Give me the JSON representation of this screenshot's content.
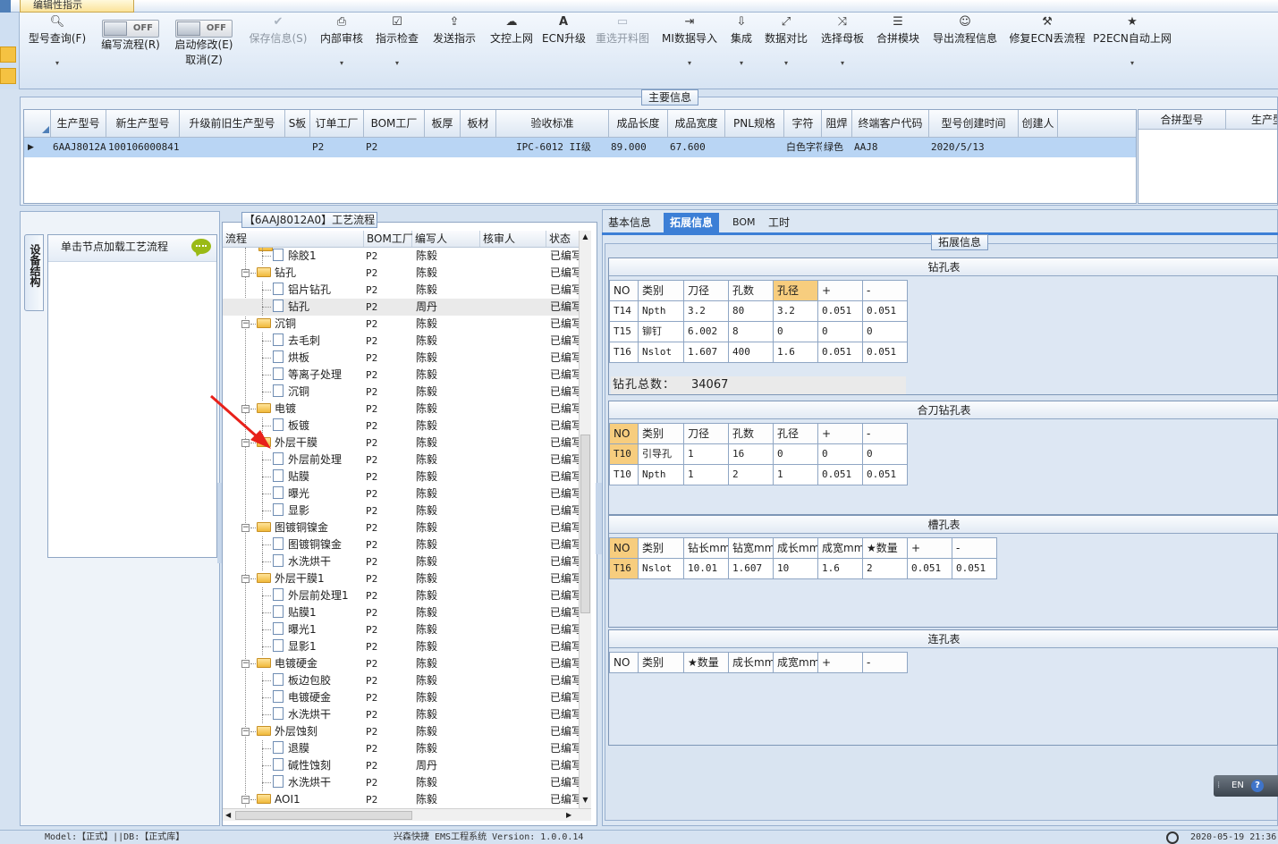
{
  "window": {
    "doc_tab": "编辑性指示"
  },
  "ribbon": {
    "buttons": [
      {
        "label": "型号查询(F)",
        "icon": "search-icon",
        "enabled": true,
        "dropdown": true
      },
      {
        "label": "保存信息(S)",
        "icon": "check-icon",
        "enabled": false
      },
      {
        "label": "内部审核",
        "icon": "print-icon",
        "enabled": true,
        "dropdown": true
      },
      {
        "label": "指示检查",
        "icon": "checkbox-icon",
        "enabled": true,
        "dropdown": true
      },
      {
        "label": "发送指示",
        "icon": "upload-icon",
        "enabled": true
      },
      {
        "label": "文控上网",
        "icon": "cloud-upload-icon",
        "enabled": true
      },
      {
        "label": "ECN升级",
        "icon": "ecn-icon",
        "enabled": true
      },
      {
        "label": "重选开料图",
        "icon": "image-icon",
        "enabled": false
      },
      {
        "label": "MI数据导入",
        "icon": "import-icon",
        "enabled": true,
        "dropdown": true
      },
      {
        "label": "集成",
        "icon": "download-icon",
        "enabled": true,
        "dropdown": true
      },
      {
        "label": "数据对比",
        "icon": "compare-icon",
        "enabled": true,
        "dropdown": true
      },
      {
        "label": "选择母板",
        "icon": "shuffle-icon",
        "enabled": true,
        "dropdown": true
      },
      {
        "label": "合拼模块",
        "icon": "list-icon",
        "enabled": true
      },
      {
        "label": "导出流程信息",
        "icon": "smiley-icon",
        "enabled": true
      },
      {
        "label": "修复ECN丢流程",
        "icon": "wrench-icon",
        "enabled": true
      },
      {
        "label": "P2ECN自动上网",
        "icon": "star-icon",
        "enabled": true,
        "dropdown": true
      }
    ],
    "toggles": [
      {
        "state": "OFF",
        "label1": "编写流程(R)",
        "label2": ""
      },
      {
        "state": "OFF",
        "label1": "启动修改(E)",
        "label2": "取消(Z)"
      }
    ]
  },
  "main_info": {
    "title": "主要信息",
    "columns": [
      "生产型号",
      "新生产型号",
      "升级前旧生产型号",
      "S板",
      "订单工厂",
      "BOM工厂",
      "板厚",
      "板材",
      "验收标准",
      "成品长度",
      "成品宽度",
      "PNL规格",
      "字符",
      "阻焊",
      "终端客户代码",
      "型号创建时间",
      "创建人"
    ],
    "row": [
      "6AAJ8012A0",
      "10010600084143",
      "",
      "",
      "P2",
      "P2",
      "",
      "",
      "IPC-6012 II级",
      "89.000",
      "67.600",
      "",
      "白色字符",
      "绿色",
      "AAJ8",
      "2020/5/13",
      ""
    ],
    "side_columns": [
      "合拼型号",
      "生产型"
    ]
  },
  "left_panel": {
    "vertical_tab": "设备结构",
    "hint": "单击节点加载工艺流程"
  },
  "flow": {
    "title": "【6AAJ8012A0】工艺流程",
    "columns": [
      "流程",
      "BOM工厂",
      "编写人",
      "核审人",
      "状态"
    ],
    "rows": [
      {
        "name": "除胶1",
        "level": 1,
        "type": "doc",
        "bom": "P2",
        "author": "陈毅",
        "reviewer": "",
        "status": "已编写"
      },
      {
        "name": "钻孔",
        "level": 0,
        "type": "folder",
        "bom": "P2",
        "author": "陈毅",
        "reviewer": "",
        "status": "已编写"
      },
      {
        "name": "铝片钻孔",
        "level": 1,
        "type": "doc",
        "bom": "P2",
        "author": "陈毅",
        "reviewer": "",
        "status": "已编写"
      },
      {
        "name": "钻孔",
        "level": 1,
        "type": "doc",
        "bom": "P2",
        "author": "周丹",
        "reviewer": "",
        "status": "已编写",
        "selected": true
      },
      {
        "name": "沉铜",
        "level": 0,
        "type": "folder",
        "bom": "P2",
        "author": "陈毅",
        "reviewer": "",
        "status": "已编写"
      },
      {
        "name": "去毛刺",
        "level": 1,
        "type": "doc",
        "bom": "P2",
        "author": "陈毅",
        "reviewer": "",
        "status": "已编写"
      },
      {
        "name": "烘板",
        "level": 1,
        "type": "doc",
        "bom": "P2",
        "author": "陈毅",
        "reviewer": "",
        "status": "已编写"
      },
      {
        "name": "等离子处理",
        "level": 1,
        "type": "doc",
        "bom": "P2",
        "author": "陈毅",
        "reviewer": "",
        "status": "已编写"
      },
      {
        "name": "沉铜",
        "level": 1,
        "type": "doc",
        "bom": "P2",
        "author": "陈毅",
        "reviewer": "",
        "status": "已编写"
      },
      {
        "name": "电镀",
        "level": 0,
        "type": "folder",
        "bom": "P2",
        "author": "陈毅",
        "reviewer": "",
        "status": "已编写"
      },
      {
        "name": "板镀",
        "level": 1,
        "type": "doc",
        "bom": "P2",
        "author": "陈毅",
        "reviewer": "",
        "status": "已编写"
      },
      {
        "name": "外层干膜",
        "level": 0,
        "type": "folder",
        "bom": "P2",
        "author": "陈毅",
        "reviewer": "",
        "status": "已编写"
      },
      {
        "name": "外层前处理",
        "level": 1,
        "type": "doc",
        "bom": "P2",
        "author": "陈毅",
        "reviewer": "",
        "status": "已编写"
      },
      {
        "name": "贴膜",
        "level": 1,
        "type": "doc",
        "bom": "P2",
        "author": "陈毅",
        "reviewer": "",
        "status": "已编写"
      },
      {
        "name": "曝光",
        "level": 1,
        "type": "doc",
        "bom": "P2",
        "author": "陈毅",
        "reviewer": "",
        "status": "已编写"
      },
      {
        "name": "显影",
        "level": 1,
        "type": "doc",
        "bom": "P2",
        "author": "陈毅",
        "reviewer": "",
        "status": "已编写"
      },
      {
        "name": "图镀铜镍金",
        "level": 0,
        "type": "folder",
        "bom": "P2",
        "author": "陈毅",
        "reviewer": "",
        "status": "已编写"
      },
      {
        "name": "图镀铜镍金",
        "level": 1,
        "type": "doc",
        "bom": "P2",
        "author": "陈毅",
        "reviewer": "",
        "status": "已编写"
      },
      {
        "name": "水洗烘干",
        "level": 1,
        "type": "doc",
        "bom": "P2",
        "author": "陈毅",
        "reviewer": "",
        "status": "已编写"
      },
      {
        "name": "外层干膜1",
        "level": 0,
        "type": "folder",
        "bom": "P2",
        "author": "陈毅",
        "reviewer": "",
        "status": "已编写"
      },
      {
        "name": "外层前处理1",
        "level": 1,
        "type": "doc",
        "bom": "P2",
        "author": "陈毅",
        "reviewer": "",
        "status": "已编写"
      },
      {
        "name": "贴膜1",
        "level": 1,
        "type": "doc",
        "bom": "P2",
        "author": "陈毅",
        "reviewer": "",
        "status": "已编写"
      },
      {
        "name": "曝光1",
        "level": 1,
        "type": "doc",
        "bom": "P2",
        "author": "陈毅",
        "reviewer": "",
        "status": "已编写"
      },
      {
        "name": "显影1",
        "level": 1,
        "type": "doc",
        "bom": "P2",
        "author": "陈毅",
        "reviewer": "",
        "status": "已编写"
      },
      {
        "name": "电镀硬金",
        "level": 0,
        "type": "folder",
        "bom": "P2",
        "author": "陈毅",
        "reviewer": "",
        "status": "已编写"
      },
      {
        "name": "板边包胶",
        "level": 1,
        "type": "doc",
        "bom": "P2",
        "author": "陈毅",
        "reviewer": "",
        "status": "已编写"
      },
      {
        "name": "电镀硬金",
        "level": 1,
        "type": "doc",
        "bom": "P2",
        "author": "陈毅",
        "reviewer": "",
        "status": "已编写"
      },
      {
        "name": "水洗烘干",
        "level": 1,
        "type": "doc",
        "bom": "P2",
        "author": "陈毅",
        "reviewer": "",
        "status": "已编写"
      },
      {
        "name": "外层蚀刻",
        "level": 0,
        "type": "folder",
        "bom": "P2",
        "author": "陈毅",
        "reviewer": "",
        "status": "已编写"
      },
      {
        "name": "退膜",
        "level": 1,
        "type": "doc",
        "bom": "P2",
        "author": "陈毅",
        "reviewer": "",
        "status": "已编写"
      },
      {
        "name": "碱性蚀刻",
        "level": 1,
        "type": "doc",
        "bom": "P2",
        "author": "周丹",
        "reviewer": "",
        "status": "已编写"
      },
      {
        "name": "水洗烘干",
        "level": 1,
        "type": "doc",
        "bom": "P2",
        "author": "陈毅",
        "reviewer": "",
        "status": "已编写"
      },
      {
        "name": "AOI1",
        "level": 0,
        "type": "folder",
        "bom": "P2",
        "author": "陈毅",
        "reviewer": "",
        "status": "已编写"
      }
    ]
  },
  "right_tabs": [
    "基本信息",
    "拓展信息",
    "BOM",
    "工时"
  ],
  "right_tabs_active": 1,
  "ext_title": "拓展信息",
  "drill_table": {
    "title": "钻孔表",
    "headers": [
      "NO",
      "类别",
      "刀径",
      "孔数",
      "孔径",
      "+",
      "-"
    ],
    "rows": [
      [
        "T14",
        "Npth",
        "3.2",
        "80",
        "3.2",
        "0.051",
        "0.051"
      ],
      [
        "T15",
        "铆钉",
        "6.002",
        "8",
        "0",
        "0",
        "0"
      ],
      [
        "T16",
        "Nslot",
        "1.607",
        "400",
        "1.6",
        "0.051",
        "0.051"
      ]
    ],
    "total_label": "钻孔总数：",
    "total_value": "34067"
  },
  "combined_drill_table": {
    "title": "合刀钻孔表",
    "headers": [
      "NO",
      "类别",
      "刀径",
      "孔数",
      "孔径",
      "+",
      "-"
    ],
    "rows": [
      [
        "T10",
        "引导孔",
        "1",
        "16",
        "0",
        "0",
        "0"
      ],
      [
        "T10",
        "Npth",
        "1",
        "2",
        "1",
        "0.051",
        "0.051"
      ]
    ]
  },
  "slot_table": {
    "title": "槽孔表",
    "headers": [
      "NO",
      "类别",
      "钻长mm",
      "钻宽mm",
      "成长mm",
      "成宽mm",
      "★数量",
      "+",
      "-"
    ],
    "rows": [
      [
        "T16",
        "Nslot",
        "10.01",
        "1.607",
        "10",
        "1.6",
        "2",
        "0.051",
        "0.051"
      ]
    ]
  },
  "link_table": {
    "title": "连孔表",
    "headers": [
      "NO",
      "类别",
      "★数量",
      "成长mm",
      "成宽mm",
      "+",
      "-"
    ],
    "rows": []
  },
  "lang_badge": "EN",
  "status": {
    "left": "Model:【正式】||DB:【正式库】",
    "center": "兴森快捷 EMS工程系统 Version: 1.0.0.14",
    "right": "2020-05-19 21:36"
  },
  "colors": {
    "accent": "#3c7fd6",
    "selected_row": "#b9d5f4",
    "highlight_cell": "#f7cd7e",
    "annotation_arrow": "#e8211a"
  }
}
